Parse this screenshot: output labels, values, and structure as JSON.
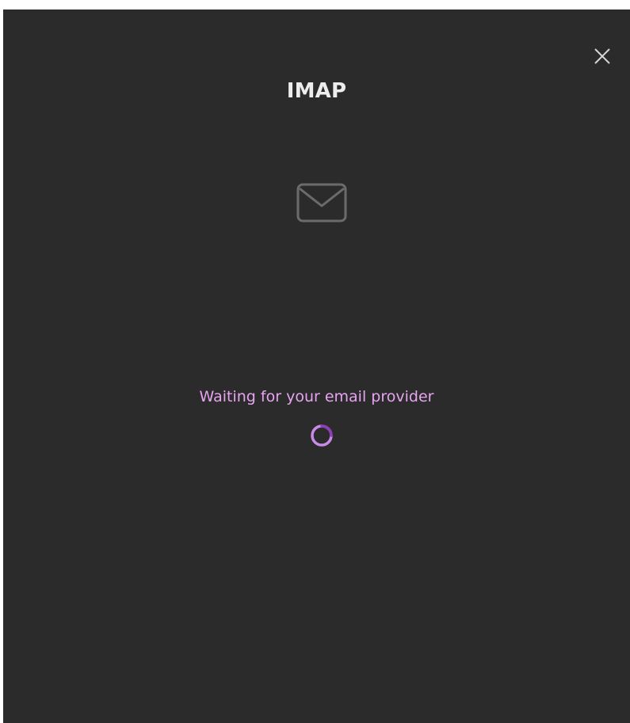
{
  "dialog": {
    "title": "IMAP",
    "status_text": "Waiting for your email provider"
  },
  "icons": {
    "close": "close-icon",
    "mail": "mail-icon",
    "spinner": "loading-spinner"
  },
  "colors": {
    "background": "#2b2b2b",
    "title": "#ededed",
    "status_text": "#e7a4f0",
    "spinner": "#a64fd6",
    "icon_stroke": "#6b6b6b"
  }
}
